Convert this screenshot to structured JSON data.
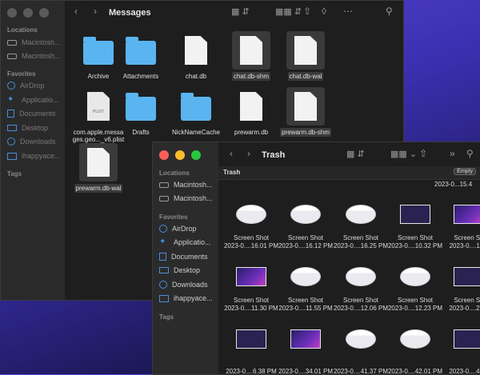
{
  "back_window": {
    "title": "Messages",
    "sidebar": {
      "locations_header": "Locations",
      "locations": [
        "Macintosh...",
        "Macintosh..."
      ],
      "favorites_header": "Favorites",
      "favorites": [
        "AirDrop",
        "Applicatio...",
        "Documents",
        "Desktop",
        "Downloads",
        "ihappyace..."
      ],
      "tags_header": "Tags"
    },
    "files": [
      {
        "name": "Archive",
        "kind": "folder",
        "selected": false
      },
      {
        "name": "Attachments",
        "kind": "folder",
        "selected": false
      },
      {
        "name": "chat.db",
        "kind": "doc",
        "selected": false
      },
      {
        "name": "chat.db-shm",
        "kind": "doc",
        "selected": true
      },
      {
        "name": "chat.db-wal",
        "kind": "doc",
        "selected": true
      },
      {
        "name": "com.apple.messa ges.geo..._v6.plist",
        "kind": "plist",
        "selected": false
      },
      {
        "name": "Drafts",
        "kind": "folder",
        "selected": false
      },
      {
        "name": "NickNameCache",
        "kind": "folder",
        "selected": false
      },
      {
        "name": "prewarm.db",
        "kind": "doc",
        "selected": false
      },
      {
        "name": "prewarm.db-shm",
        "kind": "doc",
        "selected": true
      },
      {
        "name": "prewarm.db-wal",
        "kind": "doc",
        "selected": true
      }
    ]
  },
  "front_window": {
    "title": "Trash",
    "path_label": "Trash",
    "empty_button": "Empty",
    "top_partial_label": "2023-0...15.4",
    "sidebar": {
      "locations_header": "Locations",
      "locations": [
        "Macintosh...",
        "Macintosh..."
      ],
      "favorites_header": "Favorites",
      "favorites": [
        "AirDrop",
        "Applicatio...",
        "Documents",
        "Desktop",
        "Downloads",
        "ihappyace..."
      ],
      "tags_header": "Tags"
    },
    "items": [
      {
        "line1": "Screen Shot",
        "line2": "2023-0....16.01 PM",
        "style": "light"
      },
      {
        "line1": "Screen Shot",
        "line2": "2023-0....16.12 PM",
        "style": "light"
      },
      {
        "line1": "Screen Shot",
        "line2": "2023-0....16.25 PM",
        "style": "light"
      },
      {
        "line1": "Screen Shot",
        "line2": "2023-0....10.32 PM",
        "style": "dark"
      },
      {
        "line1": "Screen Sh",
        "line2": "2023-0....11.0",
        "style": "purple"
      },
      {
        "line1": "Screen Shot",
        "line2": "2023-0....11.30 PM",
        "style": "purple"
      },
      {
        "line1": "Screen Shot",
        "line2": "2023-0....11.55 PM",
        "style": "light"
      },
      {
        "line1": "Screen Shot",
        "line2": "2023-0....12.06 PM",
        "style": "light"
      },
      {
        "line1": "Screen Shot",
        "line2": "2023-0....12.23 PM",
        "style": "light"
      },
      {
        "line1": "Screen Sh",
        "line2": "2023-0....21.2",
        "style": "dark"
      },
      {
        "line1": "",
        "line2": "2023-0....6.38 PM",
        "style": "dark"
      },
      {
        "line1": "",
        "line2": "2023-0....34.01 PM",
        "style": "purple"
      },
      {
        "line1": "",
        "line2": "2023-0....41.37 PM",
        "style": "light"
      },
      {
        "line1": "",
        "line2": "2023-0....42.01 PM",
        "style": "light"
      },
      {
        "line1": "",
        "line2": "2023-0....42.1",
        "style": "dark"
      }
    ]
  }
}
